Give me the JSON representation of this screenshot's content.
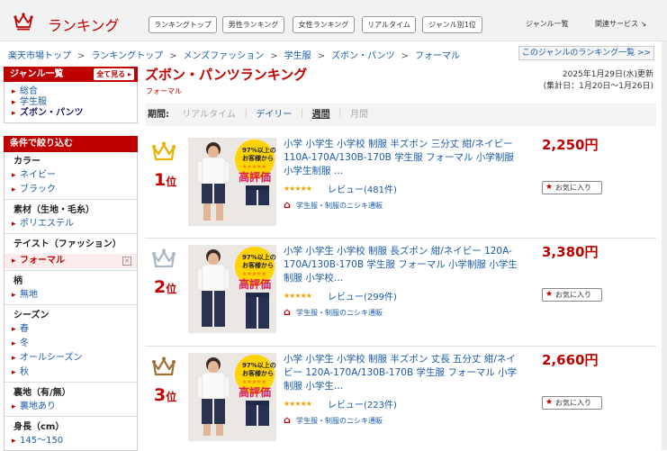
{
  "header": {
    "logo_text": "ランキング",
    "tabs": [
      "ランキングトップ",
      "男性ランキング",
      "女性ランキング",
      "リアルタイム",
      "ジャンル別1位"
    ],
    "links": [
      "ジャンル一覧",
      "関連サービス ↘"
    ]
  },
  "breadcrumb": [
    "楽天市場トップ",
    "ランキングトップ",
    "メンズファッション",
    "学生服",
    "ズボン・パンツ",
    "フォーマル"
  ],
  "genre_list_link": "このジャンルのランキング一覧 >>",
  "sidebar": {
    "genre_title": "ジャンル一覧",
    "all_button": "全て見る",
    "genres": [
      {
        "label": "総合",
        "selected": false
      },
      {
        "label": "学生服",
        "selected": false
      },
      {
        "label": "ズボン・パンツ",
        "selected": true
      }
    ],
    "filter_title": "条件で絞り込む",
    "sections": [
      {
        "title": "カラー",
        "options": [
          "ネイビー",
          "ブラック"
        ]
      },
      {
        "title": "素材（生地・毛糸）",
        "options": [
          "ポリエステル"
        ]
      },
      {
        "title": "テイスト（ファッション）",
        "options": [
          "フォーマル"
        ],
        "selected": "フォーマル"
      },
      {
        "title": "柄",
        "options": [
          "無地"
        ]
      },
      {
        "title": "シーズン",
        "options": [
          "春",
          "冬",
          "オールシーズン",
          "秋"
        ]
      },
      {
        "title": "裏地（有/無）",
        "options": [
          "裏地あり"
        ]
      },
      {
        "title": "身長（cm）",
        "options": [
          "145～150"
        ]
      }
    ]
  },
  "main": {
    "title": "ズボン・パンツランキング",
    "subtitle": "フォーマル",
    "date_line1": "2025年1月29日(水)更新",
    "date_line2": "(集計日：1月20日〜1月26日)",
    "period_label": "期間:",
    "periods": [
      {
        "label": "リアルタイム",
        "state": "disabled"
      },
      {
        "label": "デイリー",
        "state": "link"
      },
      {
        "label": "週間",
        "state": "current"
      },
      {
        "label": "月間",
        "state": "disabled"
      }
    ]
  },
  "items": [
    {
      "rank": "1",
      "rank_suffix": "位",
      "crown_color": "#e6b400",
      "title": "小学 小学生 小学校 制服 半ズボン 三分丈 紺/ネイビー 110A-170A/130B-170B 学生服 フォーマル 小学制服 小学生制服 …",
      "stars": "★★★★★",
      "review": "レビュー(481件)",
      "shop": "学生服・制服のニシキ通販",
      "price": "2,250円",
      "favorite": "お気に入り",
      "badge_top": "97%以上の",
      "badge_mid": "お客様から",
      "badge_main": "高評価",
      "pants": "short"
    },
    {
      "rank": "2",
      "rank_suffix": "位",
      "crown_color": "#a9b8c6",
      "title": "小学 小学生 小学校 制服 長ズボン 紺/ネイビー 120A-170A/130B-170B 学生服 フォーマル 小学制服 小学生制服 小学校…",
      "stars": "★★★★★",
      "review": "レビュー(299件)",
      "shop": "学生服・制服のニシキ通販",
      "price": "3,380円",
      "favorite": "お気に入り",
      "badge_top": "97%以上の",
      "badge_mid": "お客様から",
      "badge_main": "高評価",
      "pants": "long"
    },
    {
      "rank": "3",
      "rank_suffix": "位",
      "crown_color": "#a0703a",
      "title": "小学 小学生 小学校 制服 半ズボン 丈長 五分丈 紺/ネイビー 120A-170A/130B-170B 学生服 フォーマル 小学制服 小学生…",
      "stars": "★★★★★",
      "review": "レビュー(223件)",
      "shop": "学生服・制服のニシキ通販",
      "price": "2,660円",
      "favorite": "お気に入り",
      "badge_top": "97%以上の",
      "badge_mid": "お客様から",
      "badge_main": "高評価",
      "pants": "mid"
    }
  ]
}
